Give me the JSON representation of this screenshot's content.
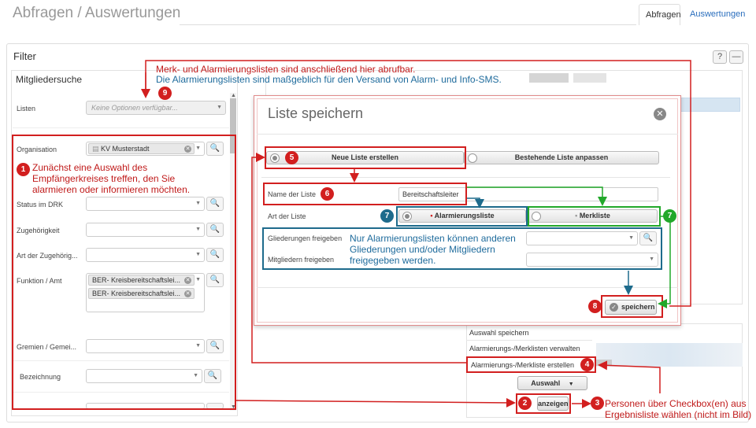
{
  "header": {
    "title": "Abfragen / Auswertungen",
    "tabs": [
      {
        "label": "Abfragen"
      },
      {
        "label": "Auswertungen"
      }
    ]
  },
  "filter": {
    "title": "Filter",
    "help_icon": "?",
    "collapse_icon": "—",
    "subpanel_title": "Mitgliedersuche",
    "fields": {
      "listen": {
        "label": "Listen",
        "placeholder": "Keine Optionen verfügbar..."
      },
      "organisation": {
        "label": "Organisation",
        "value": "KV Musterstadt"
      },
      "status": {
        "label": "Status im DRK"
      },
      "zugehoerigkeit": {
        "label": "Zugehörigkeit"
      },
      "art": {
        "label": "Art der Zugehörig..."
      },
      "funktion": {
        "label": "Funktion / Amt",
        "tags": [
          "BER- Kreisbereitschaftslei...",
          "BER- Kreisbereitschaftslei..."
        ]
      },
      "gremien": {
        "label": "Gremien / Gemei..."
      },
      "bezeichnung": {
        "label": "Bezeichnung"
      }
    }
  },
  "modal": {
    "title": "Liste speichern",
    "close_icon": "✕",
    "mode_new": "Neue Liste erstellen",
    "mode_existing": "Bestehende Liste anpassen",
    "name_label": "Name der Liste",
    "name_value": "Bereitschaftsleiter",
    "type_label": "Art der Liste",
    "type_alarm": "Alarmierungsliste",
    "type_merk": "Merkliste",
    "gliederungen_label": "Gliederungen freigeben",
    "mitglieder_label": "Mitgliedern freigeben",
    "save_label": "speichern"
  },
  "menu": {
    "items": [
      "Auswahl speichern",
      "Alarmierungs-/Merklisten verwalten",
      "Alarmierungs-/Merkliste erstellen"
    ],
    "auswahl_label": "Auswahl",
    "anzeigen_label": "anzeigen"
  },
  "annotations": {
    "n1": "Zunächst eine Auswahl des Empfängerkreises treffen, den Sie alarmieren oder informieren möchten.",
    "n9_line1": "Merk- und Alarmierungslisten sind anschließend hier abrufbar.",
    "n9_line2": "Die Alarmierungslisten sind maßgeblich für den Versand von Alarm- und Info-SMS.",
    "n7": "Nur Alarmierungslisten können anderen Gliederungen und/oder Mitgliedern freigegeben werden.",
    "n3": "Personen über Checkbox(en) aus Ergebnisliste wählen (nicht im Bild)",
    "badges": [
      "1",
      "2",
      "3",
      "4",
      "5",
      "6",
      "7",
      "8",
      "9"
    ]
  },
  "colors": {
    "annot_red": "#d21f1f",
    "annot_teal": "#1e6b8c",
    "annot_green": "#22a82a",
    "link_blue": "#2a6ebd"
  }
}
